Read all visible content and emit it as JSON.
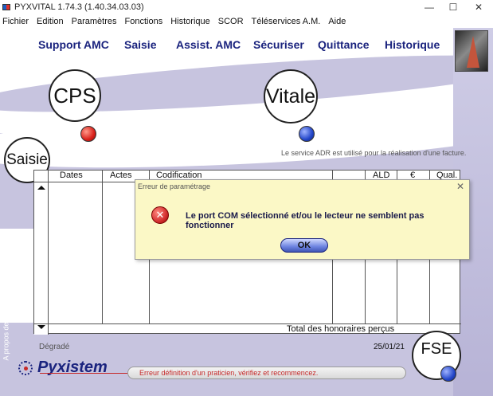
{
  "window": {
    "title": "PYXVITAL 1.74.3 (1.40.34.03.03)",
    "controls": {
      "minimize": "—",
      "maximize": "☐",
      "close": "✕"
    }
  },
  "menu": [
    "Fichier",
    "Edition",
    "Paramètres",
    "Fonctions",
    "Historique",
    "SCOR",
    "Téléservices A.M.",
    "Aide"
  ],
  "nav": {
    "support_amc": "Support AMC",
    "saisie": "Saisie",
    "assist_amc": "Assist. AMC",
    "securiser": "Sécuriser",
    "quittance": "Quittance",
    "historique": "Historique"
  },
  "cards": {
    "cps": "CPS",
    "vitale": "Vitale",
    "saisie": "Saisie",
    "fse": "FSE"
  },
  "adr_note": "Le service ADR est utilisé pour la réalisation d'une facture.",
  "table": {
    "headers": [
      "Dates",
      "Actes",
      "Codification",
      "ALD",
      "€",
      "Qual."
    ],
    "total_label": "Total des honoraires perçus"
  },
  "footer": {
    "mode": "Dégradé",
    "date": "25/01/21",
    "brand": "Pyxistem",
    "status_message": "Erreur définition d'un praticien, vérifiez et recommencez.",
    "about": "A propos de Pyxistem"
  },
  "dialog": {
    "title": "Erreur de paramétrage",
    "close": "✕",
    "icon": "error-icon",
    "message": "Le port COM sélectionné et/ou le lecteur ne semblent pas fonctionner",
    "ok": "OK"
  },
  "colors": {
    "nav_text": "#1a237e",
    "dialog_bg": "#fbf8c6",
    "status_error": "#c62828",
    "background": "#c7c4df"
  }
}
